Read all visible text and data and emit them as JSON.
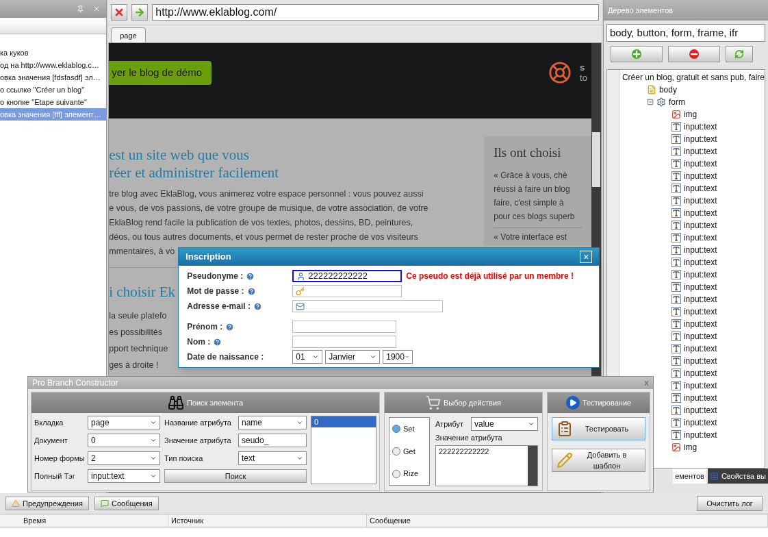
{
  "log_panel": {
    "items": [
      {
        "label": "ка куков",
        "selected": false
      },
      {
        "label": "од на http://www.eklablog.c…",
        "selected": false
      },
      {
        "label": "овка значения [fdsfasdf] эл…",
        "selected": false
      },
      {
        "label": "о ссылке \"Créer un blog\"",
        "selected": false
      },
      {
        "label": "о кнопке \"Etape suivante\"",
        "selected": false
      },
      {
        "label": "овка значения [fff] элемент…",
        "selected": true
      }
    ]
  },
  "browser": {
    "url": "http://www.eklablog.com/",
    "tabs": [
      {
        "label": "page",
        "selected": true
      }
    ],
    "page": {
      "demo_button": "yer le blog de démo",
      "header_side": [
        "s",
        "to"
      ],
      "heading_1": [
        "est un site web que vous",
        "réer et administrer facilement"
      ],
      "paragraph_1": [
        "tre blog avec EklaBlog, vous animerez votre espace personnel : vous pouvez aussi",
        "e vous, de vos passions, de votre groupe de musique, de votre association, de votre",
        "EklaBlog rend facile la publication de vos textes, photos, dessins, BD, peintures,",
        "déos, ou tous autres documents, et vous permet de rester proche de vos visiteurs",
        "mmentaires, à vo"
      ],
      "heading_2": "i choisir Ek",
      "paragraph_2": [
        "la seule platefo",
        "es possibilités",
        "pport technique",
        "ges à droite !"
      ],
      "sidebar_title": "Ils ont choisi",
      "sidebar_lines": [
        "« Grâce à vous, chè",
        "réussi à faire un blog",
        "faire, c'est simple à",
        "pour ces blogs superb"
      ],
      "sidebar_quote": "« Votre interface est"
    },
    "dialog": {
      "title": "Inscription",
      "close": "×",
      "fields": [
        {
          "kind": "login",
          "label": "Pseudonyme :",
          "value": "222222222222",
          "focused": true,
          "error": "Ce pseudo est déjà utilisé par un membre !"
        },
        {
          "kind": "password",
          "label": "Mot de passe :",
          "focused": false
        },
        {
          "kind": "email",
          "label": "Adresse e-mail :",
          "focused": false
        },
        {
          "kind": "plain",
          "label": "Prénom :",
          "focused": false
        },
        {
          "kind": "plain",
          "label": "Nom :",
          "focused": false
        },
        {
          "kind": "date",
          "label": "Date de naissance :",
          "selects": [
            "01",
            "Janvier",
            "1900"
          ]
        }
      ]
    }
  },
  "element_tree": {
    "title": "Дерево элементов",
    "filter": "body, button, form, frame, ifr",
    "nodes": [
      {
        "kind": "document",
        "label": "Créer un blog, gratuit et sans pub, faire",
        "children": [
          {
            "kind": "body",
            "label": "body"
          },
          {
            "kind": "form",
            "label": "form",
            "expanded": true,
            "children": [
              {
                "kind": "img",
                "label": "img"
              },
              {
                "kind": "input",
                "label": "input:text"
              },
              {
                "kind": "input",
                "label": "input:text"
              },
              {
                "kind": "input",
                "label": "input:text"
              },
              {
                "kind": "input",
                "label": "input:text"
              },
              {
                "kind": "input",
                "label": "input:text"
              },
              {
                "kind": "input",
                "label": "input:text"
              },
              {
                "kind": "input",
                "label": "input:text"
              },
              {
                "kind": "input",
                "label": "input:text"
              },
              {
                "kind": "input",
                "label": "input:text"
              },
              {
                "kind": "input",
                "label": "input:text"
              },
              {
                "kind": "input",
                "label": "input:text"
              },
              {
                "kind": "input",
                "label": "input:text"
              },
              {
                "kind": "input",
                "label": "input:text"
              },
              {
                "kind": "input",
                "label": "input:text"
              },
              {
                "kind": "input",
                "label": "input:text"
              },
              {
                "kind": "input",
                "label": "input:text"
              },
              {
                "kind": "input",
                "label": "input:text"
              },
              {
                "kind": "input",
                "label": "input:text"
              },
              {
                "kind": "input",
                "label": "input:text"
              },
              {
                "kind": "input",
                "label": "input:text"
              },
              {
                "kind": "input",
                "label": "input:text"
              },
              {
                "kind": "input",
                "label": "input:text"
              },
              {
                "kind": "input",
                "label": "input:text"
              },
              {
                "kind": "input",
                "label": "input:text"
              },
              {
                "kind": "input",
                "label": "input:text"
              },
              {
                "kind": "input",
                "label": "input:text"
              },
              {
                "kind": "img",
                "label": "img"
              }
            ]
          }
        ]
      }
    ],
    "bottom_tabs": [
      {
        "label": "ементов",
        "selected": true
      },
      {
        "label": "Свойства вы",
        "selected": false
      }
    ]
  },
  "constructor": {
    "title": "Pro Branch Constructor",
    "close": "x",
    "search": {
      "title": "Поиск элемента",
      "left_fields": [
        {
          "label": "Вкладка",
          "value": "page"
        },
        {
          "label": "Документ",
          "value": "0"
        },
        {
          "label": "Номер формы",
          "value": "2"
        },
        {
          "label": "Полный Тэг",
          "value": "input:text"
        }
      ],
      "right_fields": [
        {
          "kind": "select",
          "label": "Название атрибута",
          "value": "name"
        },
        {
          "kind": "input",
          "label": "Значение атрибута",
          "value": "seudo_"
        },
        {
          "kind": "select",
          "label": "Тип поиска",
          "value": "text"
        }
      ],
      "button": "Поиск",
      "results": [
        {
          "label": "0",
          "selected": true
        }
      ]
    },
    "action": {
      "title": "Выбор действия",
      "options": [
        {
          "label": "Set",
          "selected": true
        },
        {
          "label": "Get",
          "selected": false
        },
        {
          "label": "Rize",
          "selected": false
        }
      ],
      "attribute_label": "Атрибут",
      "attribute": "value",
      "value_label": "Значение атрибута",
      "value": "222222222222"
    },
    "testing": {
      "title": "Тестирование",
      "buttons": [
        {
          "kind": "test",
          "label": "Тестировать",
          "focused": true
        },
        {
          "kind": "add",
          "label": "Добавить в шаблон",
          "focused": false
        }
      ]
    }
  },
  "log": {
    "filters": [
      {
        "kind": "warning",
        "label": "Предупреждения"
      },
      {
        "kind": "message",
        "label": "Сообщения"
      }
    ],
    "clear_button": "Очистить лог",
    "columns": [
      "Время",
      "Источник",
      "Сообщение"
    ]
  }
}
